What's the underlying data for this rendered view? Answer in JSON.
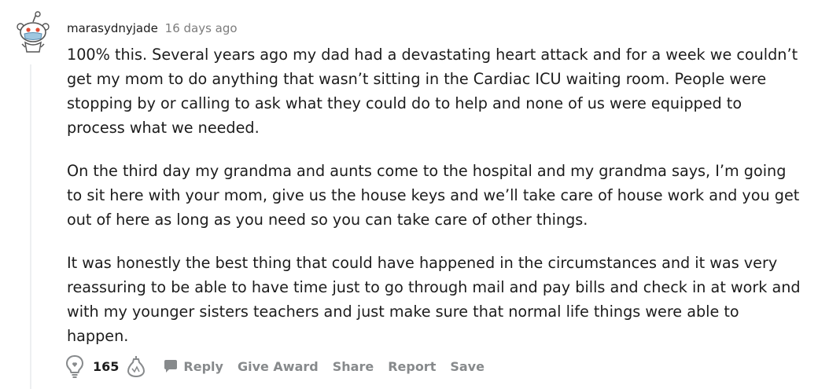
{
  "comment": {
    "author": "marasydnyjade",
    "timestamp": "16 days ago",
    "paragraphs": [
      "100% this. Several years ago my dad had a devastating heart attack and for a week we couldn’t get my mom to do anything that wasn’t sitting in the Cardiac ICU waiting room. People were stopping by or calling to ask what they could do to help and none of us were equipped to process what we needed.",
      "On the third day my grandma and aunts come to the hospital and my grandma says, I’m going to sit here with your mom, give us the house keys and we’ll take care of house work and you get out of here as long as you need so you can take care of other things.",
      "It was honestly the best thing that could have happened in the circumstances and it was very reassuring to be able to have time just to go through mail and pay bills and check in at work and with my younger sisters teachers and just make sure that normal life things were able to happen."
    ],
    "vote_count": "165",
    "actions": {
      "reply": "Reply",
      "give_award": "Give Award",
      "share": "Share",
      "report": "Report",
      "save": "Save"
    }
  },
  "icons": {
    "avatar": "snoo-avatar-icon",
    "upvote": "upvote-bulb-icon",
    "downvote": "downvote-bulb-icon",
    "reply": "speech-bubble-icon"
  },
  "colors": {
    "text": "#1c1c1c",
    "meta": "#7c7c7c",
    "action": "#878a8c",
    "thread_line": "#edeff1"
  }
}
